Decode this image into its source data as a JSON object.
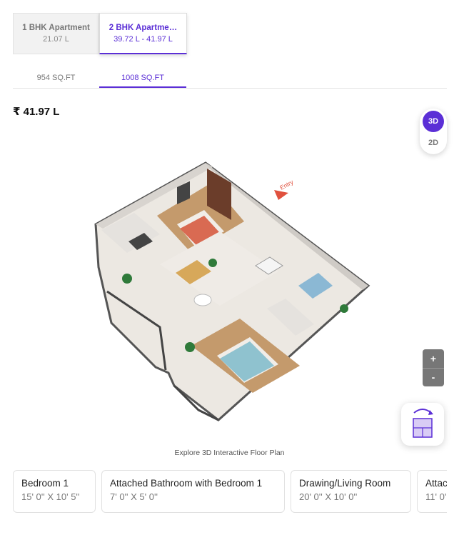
{
  "config_tabs": [
    {
      "name": "1 BHK Apartment",
      "price": "21.07 L"
    },
    {
      "name": "2 BHK Apartme…",
      "price": "39.72 L - 41.97 L"
    }
  ],
  "area_tabs": [
    {
      "label": "954 SQ.FT"
    },
    {
      "label": "1008 SQ.FT"
    }
  ],
  "price": "₹ 41.97 L",
  "view_toggle": {
    "three_d": "3D",
    "two_d": "2D",
    "selected": "3D"
  },
  "entry_label": "Entry",
  "zoom": {
    "in": "+",
    "out": "-"
  },
  "plan_button": {
    "icon": "rotate-floorplan-icon"
  },
  "explore_caption": "Explore 3D Interactive Floor Plan",
  "rooms": [
    {
      "name": "Bedroom 1",
      "dimension": "15' 0'' X 10' 5''"
    },
    {
      "name": "Attached Bathroom with Bedroom 1",
      "dimension": "7' 0'' X 5' 0''"
    },
    {
      "name": "Drawing/Living Room",
      "dimension": "20' 0'' X 10' 0''"
    },
    {
      "name": "Attac",
      "dimension": "11' 0'"
    }
  ],
  "colors": {
    "accent": "#5b2fd6",
    "entry": "#e0513e"
  }
}
